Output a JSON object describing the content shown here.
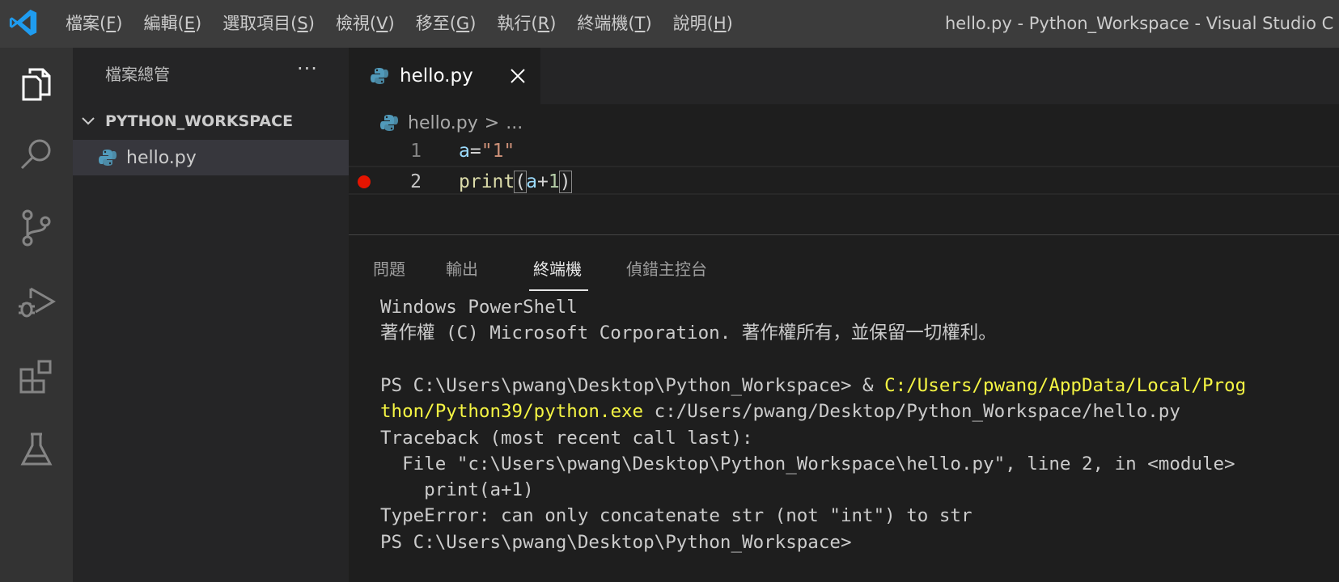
{
  "titlebar": {
    "menus": [
      {
        "label": "檔案(",
        "key": "F",
        "suffix": ")"
      },
      {
        "label": "編輯(",
        "key": "E",
        "suffix": ")"
      },
      {
        "label": "選取項目(",
        "key": "S",
        "suffix": ")"
      },
      {
        "label": "檢視(",
        "key": "V",
        "suffix": ")"
      },
      {
        "label": "移至(",
        "key": "G",
        "suffix": ")"
      },
      {
        "label": "執行(",
        "key": "R",
        "suffix": ")"
      },
      {
        "label": "終端機(",
        "key": "T",
        "suffix": ")"
      },
      {
        "label": "說明(",
        "key": "H",
        "suffix": ")"
      }
    ],
    "window_title": "hello.py - Python_Workspace - Visual Studio C"
  },
  "activity_bar": {
    "items": [
      "files-icon",
      "search-icon",
      "source-control-icon",
      "run-debug-icon",
      "extensions-icon",
      "testing-icon"
    ]
  },
  "sidebar": {
    "header": "檔案總管",
    "more": "···",
    "workspace": "PYTHON_WORKSPACE",
    "file": "hello.py"
  },
  "editor": {
    "tab_label": "hello.py",
    "breadcrumb_file": "hello.py",
    "breadcrumb_sep": ">",
    "breadcrumb_more": "...",
    "lines": [
      {
        "num": "1",
        "tokens": [
          {
            "t": "a",
            "c": "var"
          },
          {
            "t": "=",
            "c": "op"
          },
          {
            "t": "\"1\"",
            "c": "str"
          }
        ]
      },
      {
        "num": "2",
        "tokens": [
          {
            "t": "print",
            "c": "fn"
          },
          {
            "t": "(",
            "c": "bracket"
          },
          {
            "t": "a",
            "c": "var"
          },
          {
            "t": "+",
            "c": "op"
          },
          {
            "t": "1",
            "c": "num"
          },
          {
            "t": ")",
            "c": "bracket"
          }
        ],
        "breakpoint": true
      }
    ]
  },
  "panel": {
    "tabs": [
      "問題",
      "輸出",
      "終端機",
      "偵錯主控台"
    ],
    "active_tab": "終端機"
  },
  "terminal": {
    "lines": [
      [
        {
          "t": "Windows PowerShell"
        }
      ],
      [
        {
          "t": "著作權 (C) Microsoft Corporation. 著作權所有，並保留一切權利。"
        }
      ],
      [
        {
          "t": ""
        }
      ],
      [
        {
          "t": "PS C:\\Users\\pwang\\Desktop\\Python_Workspace> & "
        },
        {
          "t": "C:/Users/pwang/AppData/Local/Prog",
          "y": true
        }
      ],
      [
        {
          "t": "thon/Python39/python.exe",
          "y": true
        },
        {
          "t": " c:/Users/pwang/Desktop/Python_Workspace/hello.py"
        }
      ],
      [
        {
          "t": "Traceback (most recent call last):"
        }
      ],
      [
        {
          "t": "  File \"c:\\Users\\pwang\\Desktop\\Python_Workspace\\hello.py\", line 2, in <module>"
        }
      ],
      [
        {
          "t": "    print(a+1)"
        }
      ],
      [
        {
          "t": "TypeError: can only concatenate str (not \"int\") to str"
        }
      ],
      [
        {
          "t": "PS C:\\Users\\pwang\\Desktop\\Python_Workspace>"
        }
      ]
    ]
  },
  "colors": {
    "accent_blue": "#0078d4",
    "breakpoint_red": "#e51400",
    "terminal_yellow": "#f5f543"
  }
}
